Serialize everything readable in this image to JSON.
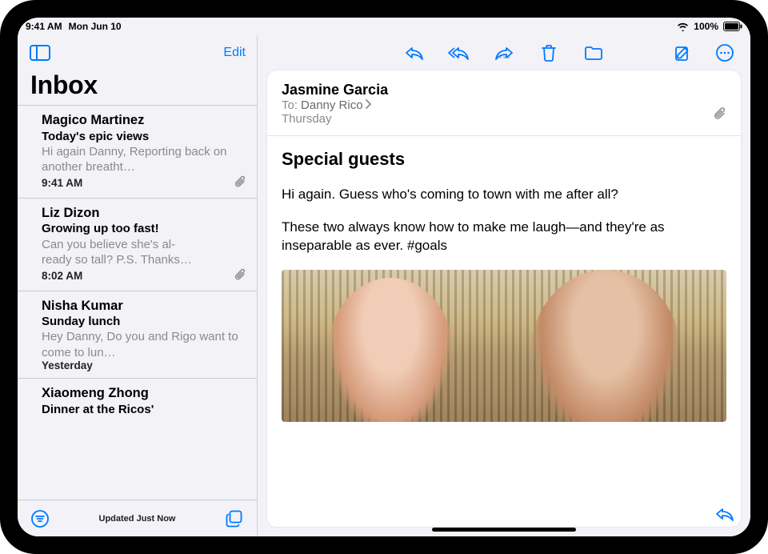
{
  "status": {
    "time": "9:41 AM",
    "date": "Mon Jun 10",
    "wifi": "wifi-icon",
    "battery": "100%"
  },
  "sidebar": {
    "edit_label": "Edit",
    "title": "Inbox",
    "updated_label": "Updated Just Now",
    "items": [
      {
        "from": "Magico Martinez",
        "subject": "Today's epic views",
        "preview": "Hi again Danny, Reporting back on another breatht…",
        "when": "9:41 AM",
        "has_attachment": true
      },
      {
        "from": "Liz Dizon",
        "subject": "Growing up too fast!",
        "preview": "Can you believe she's al-\nready so tall? P.S. Thanks…",
        "when": "8:02 AM",
        "has_attachment": true
      },
      {
        "from": "Nisha Kumar",
        "subject": "Sunday lunch",
        "preview": "Hey Danny, Do you and Rigo want to come to lun…",
        "when": "Yesterday",
        "has_attachment": false
      },
      {
        "from": "Xiaomeng Zhong",
        "subject": "Dinner at the Ricos'",
        "preview": "",
        "when": "",
        "has_attachment": false
      }
    ]
  },
  "message": {
    "sender": "Jasmine Garcia",
    "to_label": "To:",
    "recipient": "Danny Rico",
    "date": "Thursday",
    "has_attachment": true,
    "subject": "Special guests",
    "body": [
      "Hi again. Guess who's coming to town with me after all?",
      "These two always know how to make me laugh—and they're as inseparable as ever. #goals"
    ]
  },
  "toolbar": {
    "reply": "reply",
    "reply_all": "reply-all",
    "forward": "forward",
    "trash": "trash",
    "move": "move",
    "compose": "compose",
    "more": "more"
  }
}
